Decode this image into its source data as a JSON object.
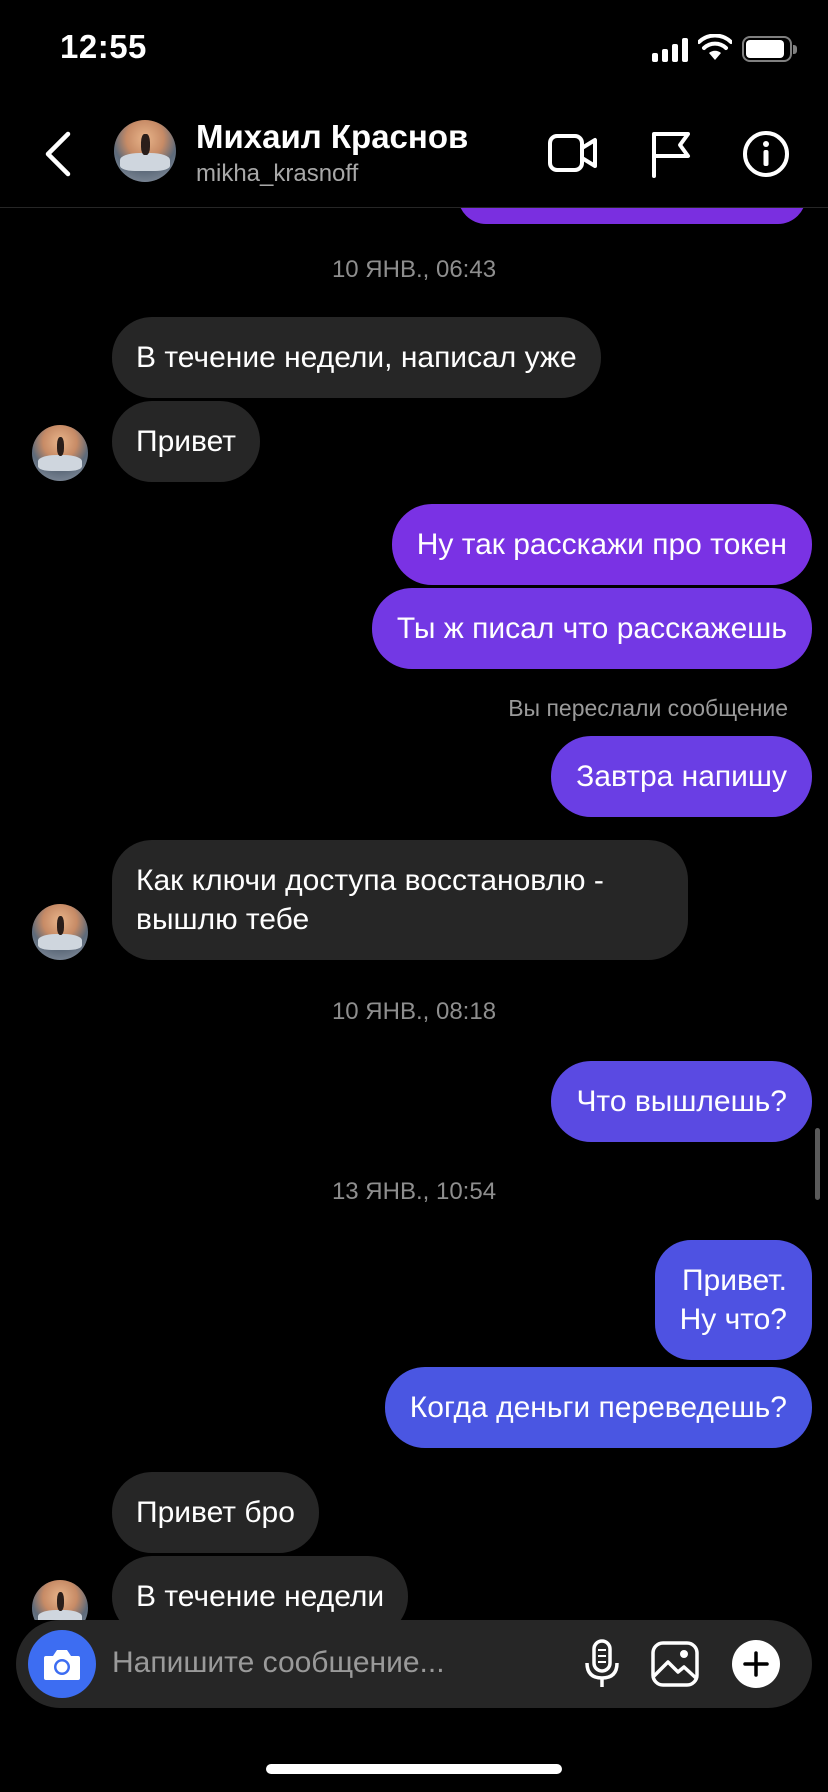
{
  "status_bar": {
    "time": "12:55"
  },
  "header": {
    "name": "Михаил Краснов",
    "username": "mikha_krasnoff",
    "icons": [
      "back-icon",
      "video-call-icon",
      "flag-icon",
      "info-icon"
    ]
  },
  "thread": {
    "timestamps": [
      "10 ЯНВ., 06:43",
      "10 ЯНВ., 08:18",
      "13 ЯНВ., 10:54"
    ],
    "messages": [
      {
        "dir": "in",
        "text": "В течение недели, написал уже"
      },
      {
        "dir": "in",
        "text": "Привет"
      },
      {
        "dir": "out",
        "text": "Ну так расскажи про токен"
      },
      {
        "dir": "out",
        "text": "Ты ж писал что расскажешь"
      },
      {
        "dir": "out",
        "text": "Завтра напишу"
      },
      {
        "dir": "in",
        "text": "Как ключи доступа восстановлю - вышлю тебе"
      },
      {
        "dir": "out",
        "text": "Что вышлешь?"
      },
      {
        "dir": "out",
        "text": "Привет.\nНу что?"
      },
      {
        "dir": "out",
        "text": "Когда деньги переведешь?"
      },
      {
        "dir": "in",
        "text": "Привет бро"
      },
      {
        "dir": "in",
        "text": "В течение недели"
      }
    ],
    "forward_note": "Вы переслали сообщение"
  },
  "composer": {
    "placeholder": "Напишите сообщение...",
    "icons": [
      "camera-icon",
      "microphone-icon",
      "gallery-icon",
      "plus-icon"
    ]
  },
  "colors": {
    "background": "#000000",
    "incoming_bubble": "#262626",
    "outgoing_purple": "#7a2fe0",
    "outgoing_blue": "#4a56e2",
    "camera_button": "#3d6df2"
  }
}
